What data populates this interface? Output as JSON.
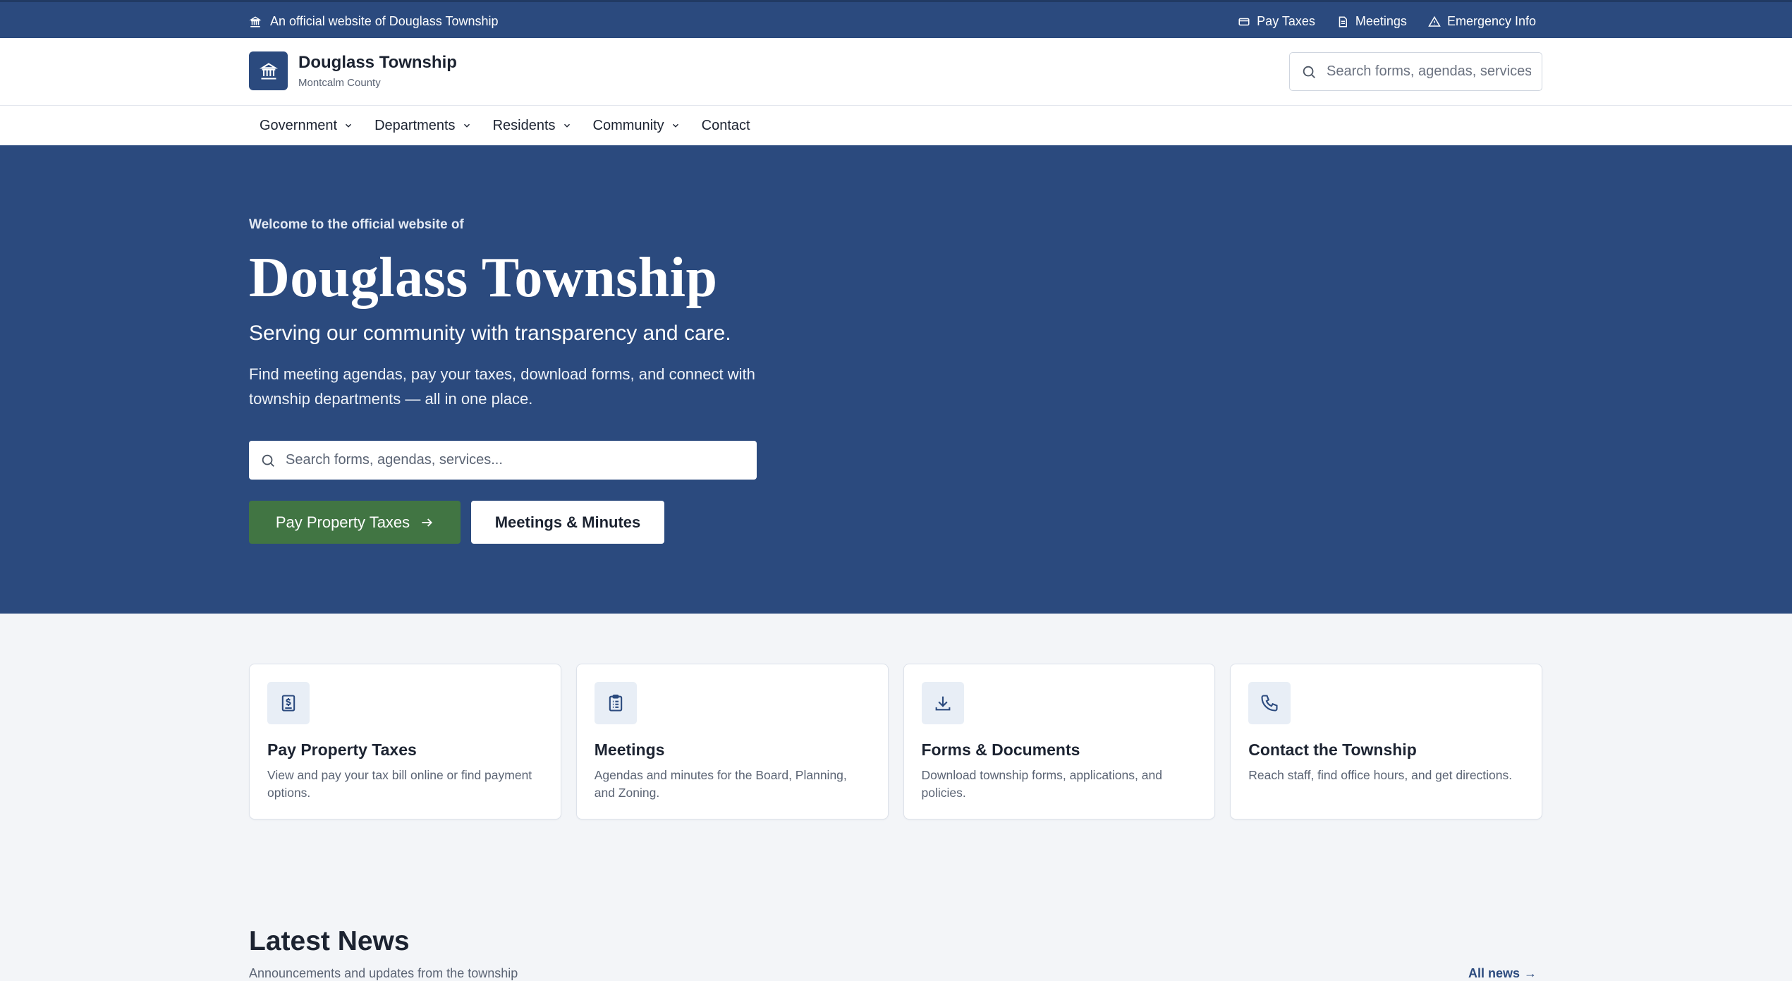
{
  "utility": {
    "official_text": "An official website of Douglass Township",
    "links": [
      {
        "label": "Pay Taxes",
        "icon": "card-icon"
      },
      {
        "label": "Meetings",
        "icon": "document-icon"
      },
      {
        "label": "Emergency Info",
        "icon": "warning-icon"
      }
    ]
  },
  "header": {
    "name": "Douglass Township",
    "county": "Montcalm County",
    "search_placeholder": "Search forms, agendas, services..."
  },
  "nav": {
    "items": [
      "Government",
      "Departments",
      "Residents",
      "Community",
      "Contact"
    ]
  },
  "hero": {
    "eyebrow": "Welcome to the official website of",
    "title": "Douglass Township",
    "tagline": "Serving our community with transparency and care.",
    "description": "Find meeting agendas, pay your taxes, download forms, and connect with township departments — all in one place.",
    "search_placeholder": "Search forms, agendas, services...",
    "primary_button": "Pay Property Taxes",
    "secondary_button": "Meetings & Minutes"
  },
  "cards": [
    {
      "title": "Pay Property Taxes",
      "desc": "View and pay your tax bill online or find payment options.",
      "icon": "dollar-document-icon"
    },
    {
      "title": "Meetings",
      "desc": "Agendas and minutes for the Board, Planning, and Zoning.",
      "icon": "clipboard-icon"
    },
    {
      "title": "Forms & Documents",
      "desc": "Download township forms, applications, and policies.",
      "icon": "download-icon"
    },
    {
      "title": "Contact the Township",
      "desc": "Reach staff, find office hours, and get directions.",
      "icon": "phone-icon"
    }
  ],
  "news": {
    "title": "Latest News",
    "subtitle": "Announcements and updates from the township",
    "all_link": "All news"
  },
  "colors": {
    "brand": "#2b4a7e",
    "primary_button": "#417543",
    "page_bg": "#f3f5f8"
  }
}
